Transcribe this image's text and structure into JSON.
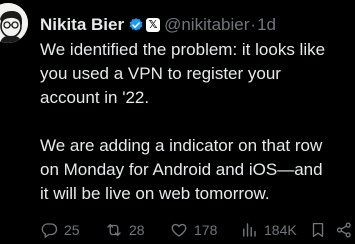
{
  "tweet": {
    "author_name": "Nikita Bier",
    "affiliate_badge": "𝕏",
    "handle": "@nikitabier",
    "separator": "·",
    "timestamp": "1d",
    "paragraphs": [
      "We identified the problem: it looks like\nyou used a VPN to register your\naccount in '22.",
      "We are adding a indicator on that row\non Monday for Android and iOS—and\nit will be live on web tomorrow."
    ]
  },
  "actions": {
    "replies": "25",
    "reposts": "28",
    "likes": "178",
    "views": "184K"
  },
  "colors": {
    "background": "#000000",
    "text": "#e7e9ea",
    "muted": "#71767b",
    "verified": "#1d9bf0"
  },
  "icons": {
    "verified": "verified-badge-icon",
    "affiliate": "x-logo-icon",
    "reply": "reply-icon",
    "repost": "repost-icon",
    "like": "heart-icon",
    "views": "views-icon",
    "bookmark": "bookmark-icon",
    "share": "share-icon",
    "more": "more-icon"
  }
}
